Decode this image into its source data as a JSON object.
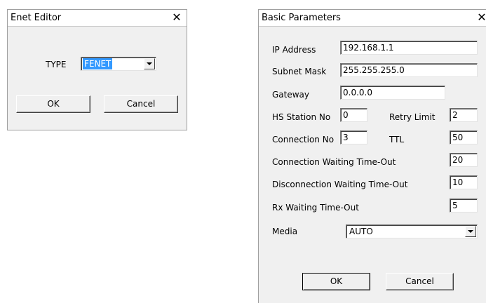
{
  "enet_editor": {
    "title": "Enet Editor",
    "close_glyph": "✕",
    "type_label": "TYPE",
    "type_value": "FENET",
    "ok_label": "OK",
    "cancel_label": "Cancel"
  },
  "basic_parameters": {
    "title": "Basic Parameters",
    "close_glyph": "✕",
    "ip_address_label": "IP Address",
    "ip_address_value": "192.168.1.1",
    "subnet_mask_label": "Subnet Mask",
    "subnet_mask_value": "255.255.255.0",
    "gateway_label": "Gateway",
    "gateway_value": "0.0.0.0",
    "hs_station_no_label": "HS Station No",
    "hs_station_no_value": "0",
    "retry_limit_label": "Retry Limit",
    "retry_limit_value": "2",
    "connection_no_label": "Connection No",
    "connection_no_value": "3",
    "ttl_label": "TTL",
    "ttl_value": "50",
    "connection_waiting_label": "Connection Waiting Time-Out",
    "connection_waiting_value": "20",
    "disconnection_waiting_label": "Disconnection Waiting Time-Out",
    "disconnection_waiting_value": "10",
    "rx_waiting_label": "Rx Waiting Time-Out",
    "rx_waiting_value": "5",
    "media_label": "Media",
    "media_value": "AUTO",
    "ok_label": "OK",
    "cancel_label": "Cancel"
  },
  "colors": {
    "dialog_bg": "#f0f0f0",
    "titlebar_bg": "#ffffff",
    "selection_bg": "#3399ff"
  }
}
